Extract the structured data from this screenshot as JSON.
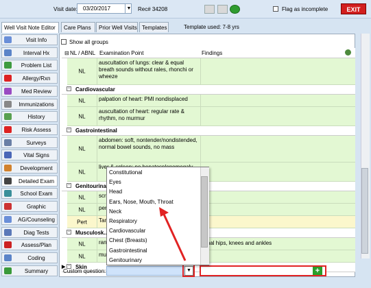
{
  "header": {
    "visit_date_label": "Visit date:",
    "visit_date_value": "03/20/2017",
    "rec_label": "Rec# 34208",
    "flag_label": "Flag as incomplete",
    "exit_label": "EXIT"
  },
  "tabs": [
    {
      "label": "Well Visit Note Editor"
    },
    {
      "label": "Care Plans"
    },
    {
      "label": "Prior Well Visits"
    },
    {
      "label": "Templates"
    }
  ],
  "template_used": "Template used:  7-8 yrs",
  "sidebar": {
    "items": [
      {
        "label": "Visit Info",
        "icon": "visit-info-icon",
        "color": "#6a8fd8"
      },
      {
        "label": "Interval Hx",
        "icon": "document-icon",
        "color": "#5b84c8"
      },
      {
        "label": "Problem List",
        "icon": "list-icon",
        "color": "#3f9b3f"
      },
      {
        "label": "Allergy/Rxn",
        "icon": "allergy-icon",
        "color": "#d22"
      },
      {
        "label": "Med Review",
        "icon": "pill-icon",
        "color": "#9a4bc2"
      },
      {
        "label": "Immunizations",
        "icon": "syringe-icon",
        "color": "#888"
      },
      {
        "label": "History",
        "icon": "history-icon",
        "color": "#59a050"
      },
      {
        "label": "Risk Assess",
        "icon": "no-sign-icon",
        "color": "#d22"
      },
      {
        "label": "Surveys",
        "icon": "survey-icon",
        "color": "#6a7fa5"
      },
      {
        "label": "Vital Signs",
        "icon": "thermometer-icon",
        "color": "#4a66b7"
      },
      {
        "label": "Development",
        "icon": "development-icon",
        "color": "#d1822e"
      },
      {
        "label": "Detailed Exam",
        "icon": "stethoscope-icon",
        "color": "#444"
      },
      {
        "label": "School Exam",
        "icon": "globe-icon",
        "color": "#3a8f9a"
      },
      {
        "label": "Graphic",
        "icon": "graphic-icon",
        "color": "#c33"
      },
      {
        "label": "AG/Counseling",
        "icon": "counseling-icon",
        "color": "#6a8fd8"
      },
      {
        "label": "Diag Tests",
        "icon": "lab-icon",
        "color": "#5a78b8"
      },
      {
        "label": "Assess/Plan",
        "icon": "plan-icon",
        "color": "#c22"
      },
      {
        "label": "Coding",
        "icon": "coding-icon",
        "color": "#5b84c8"
      },
      {
        "label": "Summary",
        "icon": "summary-icon",
        "color": "#3a9a3a"
      }
    ]
  },
  "content": {
    "show_all_label": "Show all groups",
    "col_nl": "NL / ABNL",
    "col_point": "Examination Point",
    "col_findings": "Findings"
  },
  "rows": [
    {
      "type": "row",
      "nl": "NL",
      "text": "auscultation of lungs: clear & equal breath sounds without rales, rhonchi or wheeze",
      "findings": ""
    },
    {
      "type": "section",
      "title": "Cardiovascular"
    },
    {
      "type": "row",
      "nl": "NL",
      "text": "palpation of heart: PMI nondisplaced",
      "findings": ""
    },
    {
      "type": "row",
      "nl": "NL",
      "text": "auscultation of heart: regular rate & rhythm, no murmur",
      "findings": ""
    },
    {
      "type": "section",
      "title": "Gastrointestinal"
    },
    {
      "type": "row",
      "nl": "NL",
      "text": "abdomen: soft, nontender/nondistended, normal bowel sounds, no mass",
      "findings": ""
    },
    {
      "type": "row",
      "nl": "NL",
      "text": "liver & spleen: no hepatosplenomegaly",
      "findings": ""
    },
    {
      "type": "section",
      "title": "Genitourinary"
    },
    {
      "type": "row",
      "nl": "NL",
      "text": "scr... bile...",
      "findings": ""
    },
    {
      "type": "row",
      "nl": "NL",
      "text": "per...",
      "findings": ""
    },
    {
      "type": "row",
      "nl": "Pert",
      "text": "Tan...",
      "findings": "",
      "pert": true
    },
    {
      "type": "section",
      "title": "Musculosk..."
    },
    {
      "type": "row",
      "nl": "NL",
      "text": "ran...",
      "findings": "rmal hips, knees and ankles"
    },
    {
      "type": "row",
      "nl": "NL",
      "text": "mu...",
      "findings": ""
    },
    {
      "type": "section",
      "title": "Skin",
      "arrow": true
    }
  ],
  "custom_question": {
    "label": "Custom question:"
  },
  "dropdown": {
    "options": [
      "Constitutional",
      "Eyes",
      "Head",
      "Ears, Nose, Mouth, Throat",
      "Neck",
      "Respiratory",
      "Cardiovascular",
      "Chest (Breasts)",
      "Gastrointestinal",
      "Genitourinary"
    ]
  },
  "colors": {
    "normal_row": "#e3f8d3",
    "pert_row": "#fbf7cc",
    "highlight": "#e12323",
    "exit": "#d21f1f"
  }
}
